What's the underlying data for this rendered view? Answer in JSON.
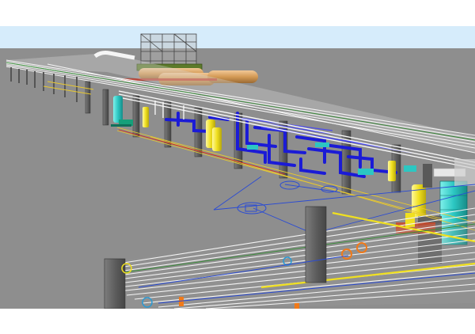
{
  "viewport": {
    "name": "3d-plant-model-viewport",
    "colors": {
      "sky": "#d6ecfb",
      "ground": "#8c8c8c",
      "ground_near": "#8f8f8f",
      "concrete": "#6b6b6b",
      "concrete_dark": "#4d4d4d",
      "pipe_white": "#f4f4f4",
      "pipe_blue": "#1b1bd6",
      "pipe_yellow": "#f0e020",
      "equipment_cyan": "#2cc7c2",
      "equipment_green": "#16a07a",
      "tank_orange": "#d49a55",
      "accent_orange": "#f07a1a",
      "accent_red": "#d8281a",
      "outline_blue": "#2a4bd4"
    }
  }
}
